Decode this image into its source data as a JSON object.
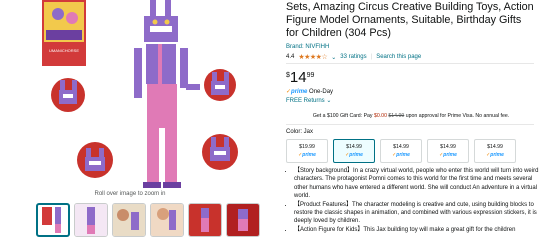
{
  "product": {
    "title": "Sets, Amazing Circus Creative Building Toys, Action Figure Model Ornaments, Suitable, Birthday Gifts for Children (304 Pcs)",
    "brand": "Brand: NIVFIHH",
    "rating_value": "4.4",
    "ratings_count": "33 ratings",
    "search_link": "Search this page",
    "price_symbol": "$",
    "price_whole": "14",
    "price_fraction": "99",
    "prime_shipping": "One-Day",
    "returns": "FREE Returns",
    "gift_card_prefix": "Get a $100 Gift Card: Pay ",
    "gift_card_pay": "$0.00",
    "gift_card_old": "$14.99",
    "gift_card_suffix": " upon approval for Prime Visa. No annual fee.",
    "color_label": "Color: Jax",
    "swatches": [
      {
        "price": "$19.99"
      },
      {
        "price": "$14.99"
      },
      {
        "price": "$14.99"
      },
      {
        "price": "$14.99"
      },
      {
        "price": "$14.99"
      }
    ],
    "bullets": [
      "【Story background】In a crazy virtual world, people who enter this world will turn into weird characters. The protagonist Pomni comes to this world for the first time and meets several other humans who have entered a different world. She will conduct An adventure in a virtual world.",
      "【Product Features】The character modeling is creative and cute, using building blocks to restore the classic shapes in animation, and combined with various expression stickers, it is deeply loved by children.",
      "【Action Figure for Kids】This Jax building toy will make a great gift for the children"
    ]
  },
  "media": {
    "zoom_hint": "Roll over image to zoom in",
    "box_text": "UMANICHORSE"
  },
  "colors": {
    "link": "#007185",
    "star": "#de7921",
    "prime": "#1a98ff",
    "price_red": "#B12704",
    "figure_purple": "#8e6bc9",
    "figure_pink": "#e07ab6",
    "circle_red": "#c8322c"
  }
}
